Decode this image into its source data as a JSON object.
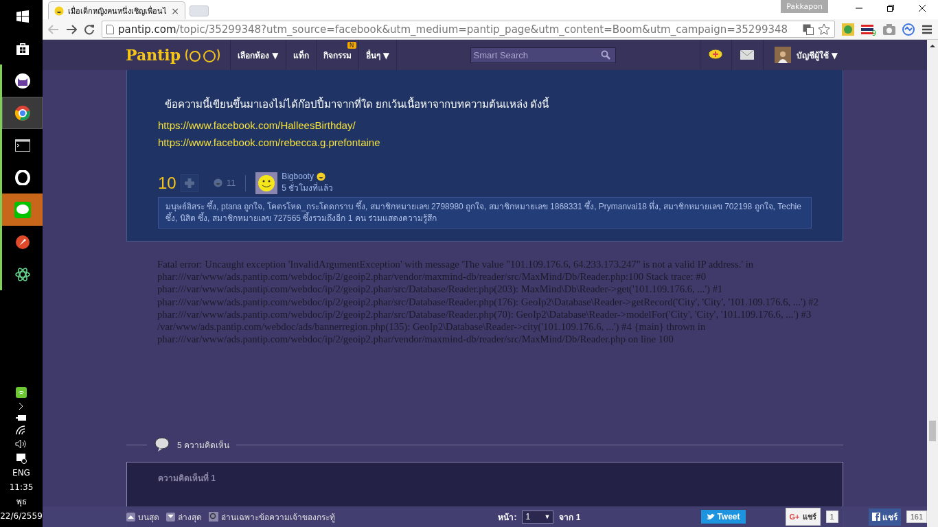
{
  "taskbar": {
    "apps": [
      {
        "running": false,
        "selected": false,
        "alert": false
      },
      {
        "running": false,
        "selected": false,
        "alert": false
      },
      {
        "running": true,
        "selected": false,
        "alert": false
      },
      {
        "running": true,
        "selected": true,
        "alert": false
      },
      {
        "running": true,
        "selected": false,
        "alert": false
      },
      {
        "running": true,
        "selected": false,
        "alert": false
      },
      {
        "running": true,
        "selected": false,
        "alert": true
      },
      {
        "running": true,
        "selected": false,
        "alert": false
      },
      {
        "running": true,
        "selected": false,
        "alert": false
      }
    ],
    "tray": {
      "language": "ENG",
      "time": "11:35",
      "day": "พุธ",
      "date": "22/6/2559"
    }
  },
  "browser": {
    "tab_title": "เมื่อเด็กหญิงคนหนึ่งเชิญเพื่อนไ",
    "tab_close": "×",
    "profile": "Pakkapon",
    "url_host": "pantip.com",
    "url_rest": "/topic/35299348?utm_source=facebook&utm_medium=pantip_page&utm_content=Boom&utm_campaign=35299348",
    "extension_badge": "9"
  },
  "navbar": {
    "logo": "Pantip",
    "menu": [
      {
        "label": "เลือกห้อง ▼"
      },
      {
        "label": "แท็ก"
      },
      {
        "label": "กิจกรรม",
        "badge": "N"
      },
      {
        "label": "อื่นๆ ▼"
      }
    ],
    "search": {
      "placeholder": "Smart Search"
    },
    "account": "บัญชีผู้ใช้ ▼"
  },
  "post": {
    "text": "ข้อความนี้เขียนขึ้นมาเองไม่ได้ก๊อปปี้มาจากที่ใด  ยกเว้นเนื้อหาจากบทความต้นแหล่ง ดังนี้",
    "links": [
      "https://www.facebook.com/HalleesBirthday/",
      "https://www.facebook.com/rebecca.g.prefontaine"
    ],
    "score": "10",
    "emotions": "11",
    "author": "Bigbooty",
    "time": "5 ชั่วโมงที่แล้ว",
    "reactions": "มนุษย์อิสระ ซึ้ง, ptana ถูกใจ, โคตรโหด_กระโดดกราบ ซึ้ง, สมาชิกหมายเลข 2798980 ถูกใจ, สมาชิกหมายเลข 1868331 ซึ้ง, Prymanvai18 ทึ่ง, สมาชิกหมายเลข 702198 ถูกใจ, Techie ซึ้ง, นิสิต ซึ้ง, สมาชิกหมายเลข 727565 ซึ้งรวมถึงอีก 1 คน ร่วมแสดงความรู้สึก"
  },
  "error": "Fatal error: Uncaught exception 'InvalidArgumentException' with message 'The value \"101.109.176.6, 64.233.173.247\" is not a valid IP address.' in phar:///var/www/ads.pantip.com/webdoc/ip/2/geoip2.phar/vendor/maxmind-db/reader/src/MaxMind/Db/Reader.php:100 Stack trace: #0 phar:///var/www/ads.pantip.com/webdoc/ip/2/geoip2.phar/src/Database/Reader.php(203): MaxMind\\Db\\Reader->get('101.109.176.6, ...') #1 phar:///var/www/ads.pantip.com/webdoc/ip/2/geoip2.phar/src/Database/Reader.php(176): GeoIp2\\Database\\Reader->getRecord('City', 'City', '101.109.176.6, ...') #2 phar:///var/www/ads.pantip.com/webdoc/ip/2/geoip2.phar/src/Database/Reader.php(70): GeoIp2\\Database\\Reader->modelFor('City', 'City', '101.109.176.6, ...') #3 /var/www/ads.pantip.com/webdoc/ads/bannerregion.php(135): GeoIp2\\Database\\Reader->city('101.109.176.6, ...') #4 {main} thrown in phar:///var/www/ads.pantip.com/webdoc/ip/2/geoip2.phar/vendor/maxmind-db/reader/src/MaxMind/Db/Reader.php on line 100",
  "comments": {
    "heading": "5 ความคิดเห็น",
    "first_title": "ความคิดเห็นที่ 1"
  },
  "bottom_bar": {
    "top": "บนสุด",
    "bottom": "ล่างสุด",
    "owner_only": "อ่านเฉพาะข้อความเจ้าของกระทู้",
    "page_label": "หน้า:",
    "page": "1",
    "page_caret": "▼",
    "of": "จาก 1",
    "tweet": "Tweet",
    "gplus_mark": "G+",
    "gplus": "แชร์",
    "gplus_count": "1",
    "fb": "แชร์",
    "fb_count": "161"
  }
}
